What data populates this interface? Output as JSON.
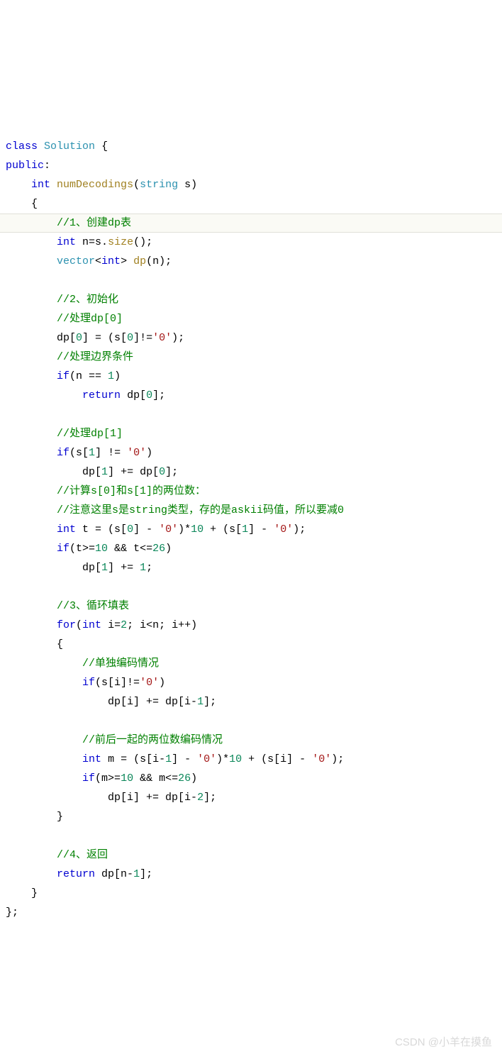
{
  "code": {
    "l1a": "class",
    "l1b": "Solution",
    "l1c": "{",
    "l2a": "public",
    "l2b": ":",
    "l3a": "int",
    "l3b": "numDecodings",
    "l3c": "(",
    "l3d": "string",
    "l3e": "s",
    "l3f": ")",
    "l4": "{",
    "l5": "//1、创建dp表",
    "l6a": "int",
    "l6b": "n=s.",
    "l6c": "size",
    "l6d": "();",
    "l7a": "vector",
    "l7b": "<",
    "l7c": "int",
    "l7d": "> ",
    "l7e": "dp",
    "l7f": "(n);",
    "l9": "//2、初始化",
    "l10": "//处理dp[0]",
    "l11a": "dp[",
    "l11b": "0",
    "l11c": "] = (s[",
    "l11d": "0",
    "l11e": "]!=",
    "l11f": "'0'",
    "l11g": ");",
    "l12": "//处理边界条件",
    "l13a": "if",
    "l13b": "(n == ",
    "l13c": "1",
    "l13d": ")",
    "l14a": "return",
    "l14b": "dp[",
    "l14c": "0",
    "l14d": "];",
    "l16": "//处理dp[1]",
    "l17a": "if",
    "l17b": "(s[",
    "l17c": "1",
    "l17d": "] != ",
    "l17e": "'0'",
    "l17f": ")",
    "l18a": "dp[",
    "l18b": "1",
    "l18c": "] += dp[",
    "l18d": "0",
    "l18e": "];",
    "l19": "//计算s[0]和s[1]的两位数：",
    "l20": "//注意这里s是string类型，存的是askii码值，所以要减0",
    "l21a": "int",
    "l21b": "t = (s[",
    "l21c": "0",
    "l21d": "] - ",
    "l21e": "'0'",
    "l21f": ")*",
    "l21g": "10",
    "l21h": " + (s[",
    "l21i": "1",
    "l21j": "] - ",
    "l21k": "'0'",
    "l21l": ");",
    "l22a": "if",
    "l22b": "(t>=",
    "l22c": "10",
    "l22d": " && t<=",
    "l22e": "26",
    "l22f": ")",
    "l23a": "dp[",
    "l23b": "1",
    "l23c": "] += ",
    "l23d": "1",
    "l23e": ";",
    "l25": "//3、循环填表",
    "l26a": "for",
    "l26b": "(",
    "l26c": "int",
    "l26d": "i=",
    "l26e": "2",
    "l26f": "; i<n; i++)",
    "l27": "{",
    "l28": "//单独编码情况",
    "l29a": "if",
    "l29b": "(s[i]!=",
    "l29c": "'0'",
    "l29d": ")",
    "l30a": "dp[i] += dp[i-",
    "l30b": "1",
    "l30c": "];",
    "l32": "//前后一起的两位数编码情况",
    "l33a": "int",
    "l33b": "m = (s[i-",
    "l33c": "1",
    "l33d": "] - ",
    "l33e": "'0'",
    "l33f": ")*",
    "l33g": "10",
    "l33h": " + (s[i] - ",
    "l33i": "'0'",
    "l33j": ");",
    "l34a": "if",
    "l34b": "(m>=",
    "l34c": "10",
    "l34d": " && m<=",
    "l34e": "26",
    "l34f": ")",
    "l35a": "dp[i] += dp[i-",
    "l35b": "2",
    "l35c": "];",
    "l36": "}",
    "l38": "//4、返回",
    "l39a": "return",
    "l39b": "dp[n-",
    "l39c": "1",
    "l39d": "];",
    "l40": "}",
    "l41": "};"
  },
  "watermark": "CSDN @小羊在摸鱼"
}
